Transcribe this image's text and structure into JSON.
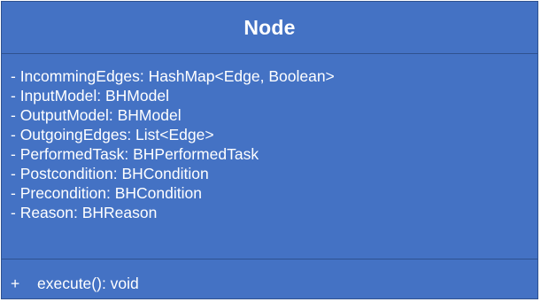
{
  "class": {
    "name": "Node",
    "fill_color": "#4472c4",
    "border_color": "#2f528f",
    "text_color": "#ffffff",
    "attributes": [
      "- IncommingEdges: HashMap<Edge, Boolean>",
      "- InputModel: BHModel",
      "- OutputModel: BHModel",
      "- OutgoingEdges: List<Edge>",
      "- PerformedTask: BHPerformedTask",
      "- Postcondition: BHCondition",
      "- Precondition: BHCondition",
      "- Reason: BHReason"
    ],
    "methods": [
      {
        "visibility": "+",
        "signature": "execute(): void"
      }
    ]
  }
}
